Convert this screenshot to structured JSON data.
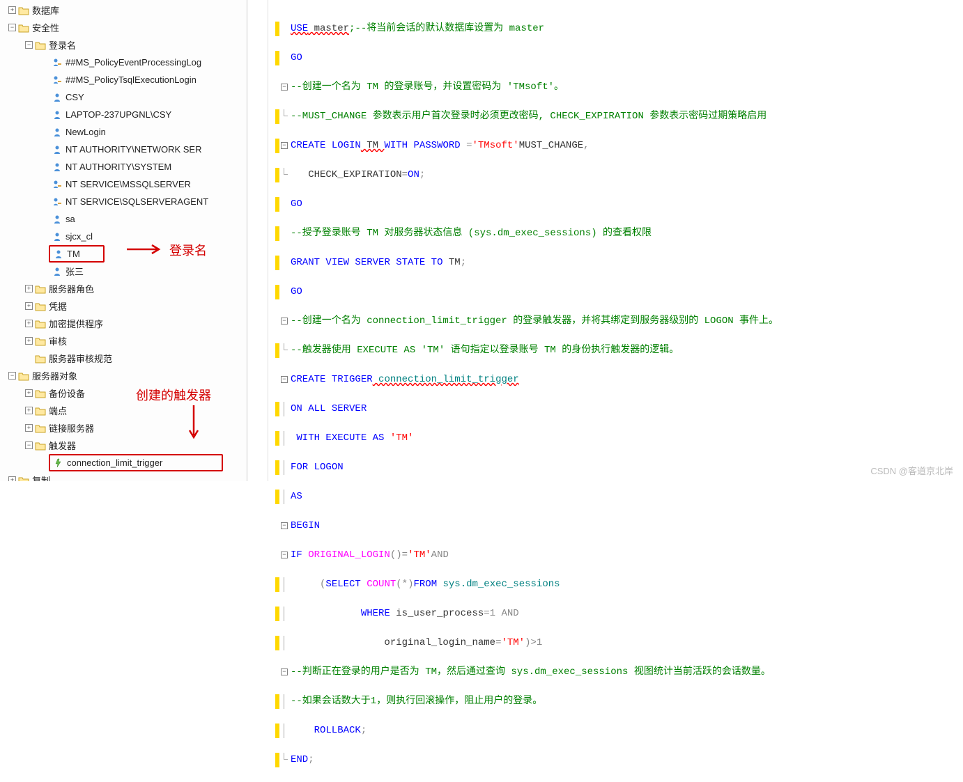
{
  "tree": {
    "db": "数据库",
    "security": "安全性",
    "logins": "登录名",
    "login_items": [
      "##MS_PolicyEventProcessingLog",
      "##MS_PolicyTsqlExecutionLogin",
      "CSY",
      "LAPTOP-237UPGNL\\CSY",
      "NewLogin",
      "NT AUTHORITY\\NETWORK SER",
      "NT AUTHORITY\\SYSTEM",
      "NT SERVICE\\MSSQLSERVER",
      "NT SERVICE\\SQLSERVERAGENT",
      "sa",
      "sjcx_cl",
      "TM",
      "张三"
    ],
    "server_roles": "服务器角色",
    "credentials": "凭据",
    "crypto": "加密提供程序",
    "audit": "审核",
    "audit_spec": "服务器审核规范",
    "server_objects": "服务器对象",
    "backup": "备份设备",
    "endpoints": "端点",
    "linked": "链接服务器",
    "triggers": "触发器",
    "trigger_item": "connection_limit_trigger",
    "replication": "复制"
  },
  "annotations": {
    "login_label": "登录名",
    "trigger_label": "创建的触发器"
  },
  "watermark": "CSDN @客道京北岸",
  "code": {
    "l1_a": "USE",
    "l1_b": " master",
    "l1_c": ";--将当前会话的默认数据库设置为 master",
    "l2": "GO",
    "l3": "--创建一个名为 TM 的登录账号，并设置密码为 'TMsoft'。",
    "l4": "--MUST_CHANGE 参数表示用户首次登录时必须更改密码, CHECK_EXPIRATION 参数表示密码过期策略启用",
    "l5_a": "CREATE",
    "l5_b": " LOGIN",
    "l5_c": " TM ",
    "l5_d": "WITH",
    "l5_e": " PASSWORD",
    "l5_f": " =",
    "l5_g": "'TMsoft'",
    "l5_h": "MUST_CHANGE",
    "l6_a": "   CHECK_EXPIRATION",
    "l6_b": "=",
    "l6_c": "ON",
    "l7": "GO",
    "l8": "--授予登录账号 TM 对服务器状态信息 (sys.dm_exec_sessions) 的查看权限",
    "l9_a": "GRANT",
    "l9_b": " VIEW",
    "l9_c": " SERVER",
    "l9_d": " STATE",
    "l9_e": " TO",
    "l9_f": " TM",
    "l10": "GO",
    "l11": "--创建一个名为 connection_limit_trigger 的登录触发器，并将其绑定到服务器级别的 LOGON 事件上。",
    "l12": "--触发器使用 EXECUTE AS 'TM' 语句指定以登录账号 TM 的身份执行触发器的逻辑。",
    "l13_a": "CREATE",
    "l13_b": " TRIGGER",
    "l13_c": " connection_limit_trigger",
    "l14_a": "ON",
    "l14_b": " ALL",
    "l14_c": " SERVER",
    "l15_a": " WITH",
    "l15_b": " EXECUTE",
    "l15_c": " AS",
    "l15_d": " 'TM'",
    "l16_a": "FOR",
    "l16_b": " LOGON",
    "l17": "AS",
    "l18": "BEGIN",
    "l19_a": "IF",
    "l19_b": " ORIGINAL_LOGIN",
    "l19_c": "()=",
    "l19_d": "'TM'",
    "l19_e": "AND",
    "l20_a": "     (",
    "l20_b": "SELECT",
    "l20_c": " COUNT",
    "l20_d": "(*)",
    "l20_e": "FROM",
    "l20_f": " sys.dm_exec_sessions",
    "l21_a": "            WHERE",
    "l21_b": " is_user_process",
    "l21_c": "=1 ",
    "l21_d": "AND",
    "l22_a": "                original_login_name",
    "l22_b": "=",
    "l22_c": "'TM'",
    "l22_d": ")>1",
    "l23": "--判断正在登录的用户是否为 TM，然后通过查询 sys.dm_exec_sessions 视图统计当前活跃的会话数量。",
    "l24": "--如果会话数大于1，则执行回滚操作，阻止用户的登录。",
    "l25": "    ROLLBACK",
    "l26": "END"
  }
}
